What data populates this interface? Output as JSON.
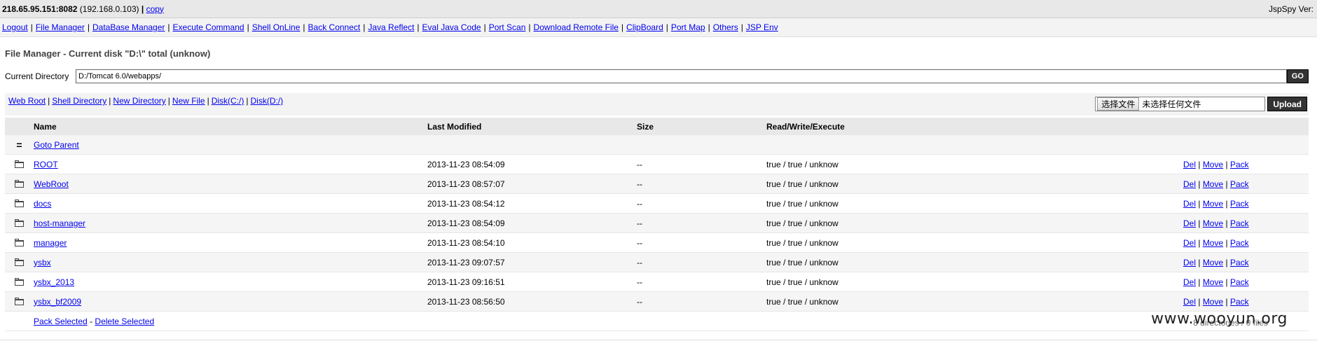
{
  "header": {
    "host": "218.65.95.151:8082",
    "ip": "(192.168.0.103)",
    "separator": "|",
    "copy_label": "copy",
    "brand": "JspSpy Ver:"
  },
  "menu": [
    "Logout",
    "File Manager",
    "DataBase Manager",
    "Execute Command",
    "Shell OnLine",
    "Back Connect",
    "Java Reflect",
    "Eval Java Code",
    "Port Scan",
    "Download Remote File",
    "ClipBoard",
    "Port Map",
    "Others",
    "JSP Env"
  ],
  "page": {
    "title": "File Manager - Current disk \"D:\\\" total (unknow)",
    "current_dir_label": "Current Directory",
    "current_dir_value": "D:/Tomcat 6.0/webapps/",
    "go_label": "GO"
  },
  "toolbar": {
    "links": [
      "Web Root",
      "Shell Directory",
      "New Directory",
      "New File",
      "Disk(C:/)",
      "Disk(D:/)"
    ],
    "choose_file_label": "选择文件",
    "no_file_text": "未选择任何文件",
    "upload_label": "Upload"
  },
  "table": {
    "headers": [
      "Name",
      "Last Modified",
      "Size",
      "Read/Write/Execute"
    ],
    "parent_icon": "=",
    "parent_label": "Goto Parent",
    "rows": [
      {
        "name": "ROOT",
        "modified": "2013-11-23 08:54:09",
        "size": "--",
        "rwx": "true / true / unknow"
      },
      {
        "name": "WebRoot",
        "modified": "2013-11-23 08:57:07",
        "size": "--",
        "rwx": "true / true / unknow"
      },
      {
        "name": "docs",
        "modified": "2013-11-23 08:54:12",
        "size": "--",
        "rwx": "true / true / unknow"
      },
      {
        "name": "host-manager",
        "modified": "2013-11-23 08:54:09",
        "size": "--",
        "rwx": "true / true / unknow"
      },
      {
        "name": "manager",
        "modified": "2013-11-23 08:54:10",
        "size": "--",
        "rwx": "true / true / unknow"
      },
      {
        "name": "ysbx",
        "modified": "2013-11-23 09:07:57",
        "size": "--",
        "rwx": "true / true / unknow"
      },
      {
        "name": "ysbx_2013",
        "modified": "2013-11-23 09:16:51",
        "size": "--",
        "rwx": "true / true / unknow"
      },
      {
        "name": "ysbx_bf2009",
        "modified": "2013-11-23 08:56:50",
        "size": "--",
        "rwx": "true / true / unknow"
      }
    ],
    "actions": [
      "Del",
      "Move",
      "Pack"
    ],
    "pack_selected": "Pack Selected",
    "dash": "-",
    "delete_selected": "Delete Selected",
    "summary": "8 directories / 0 files"
  },
  "watermark": "www.wooyun.org",
  "icons": {
    "row_icon": "folder-icon",
    "parent_icon": "parent-icon"
  }
}
